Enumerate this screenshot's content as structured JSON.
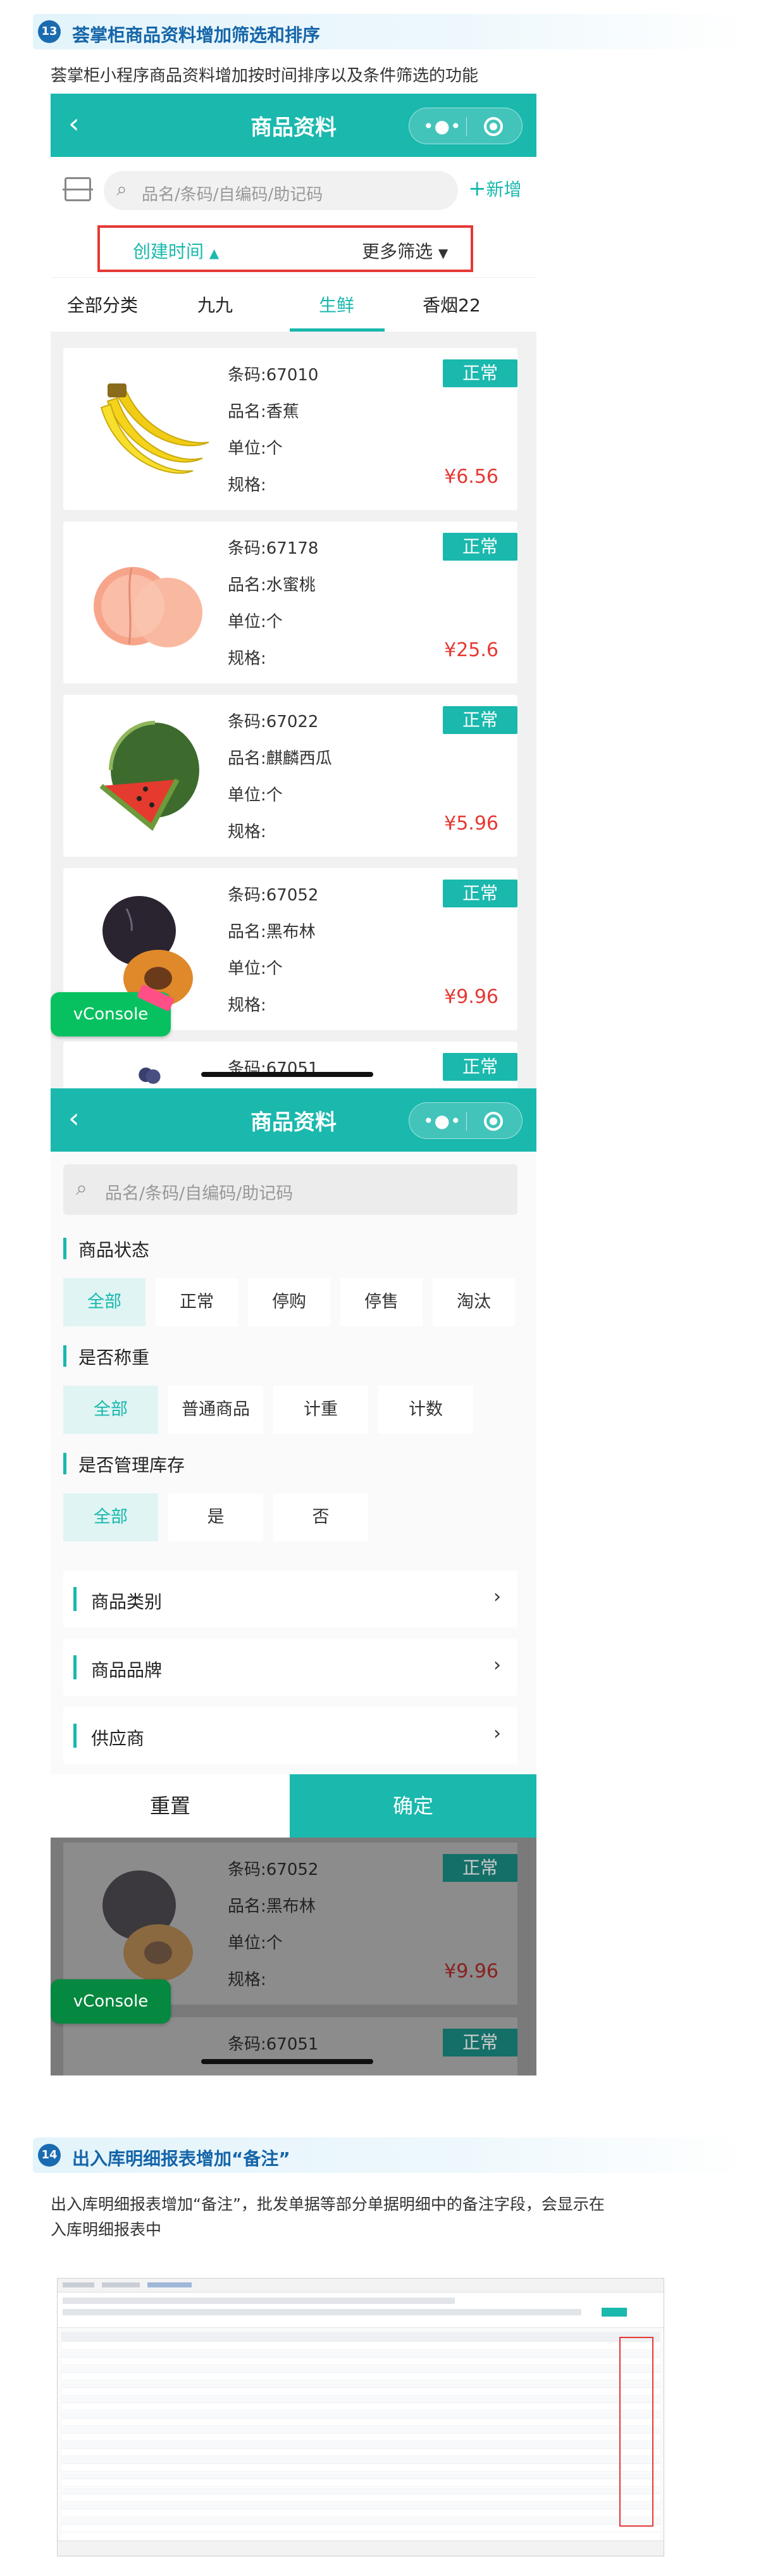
{
  "section13": {
    "number": "13",
    "title": "荟掌柜商品资料增加筛选和排序",
    "description": "荟掌柜小程序商品资料增加按时间排序以及条件筛选的功能"
  },
  "list_screen": {
    "nav_title": "商品资料",
    "search_placeholder": "品名/条码/自编码/助记码",
    "add_label": "新增",
    "sort_time": "创建时间",
    "more_filter": "更多筛选",
    "categories": [
      "全部分类",
      "九九",
      "生鲜",
      "香烟22"
    ],
    "active_category": "生鲜",
    "products": [
      {
        "barcode": "条码:67010",
        "name": "品名:香蕉",
        "unit": "单位:个",
        "spec": "规格:",
        "price": "¥6.56",
        "status": "正常",
        "icon": "banana"
      },
      {
        "barcode": "条码:67178",
        "name": "品名:水蜜桃",
        "unit": "单位:个",
        "spec": "规格:",
        "price": "¥25.6",
        "status": "正常",
        "icon": "peach"
      },
      {
        "barcode": "条码:67022",
        "name": "品名:麒麟西瓜",
        "unit": "单位:个",
        "spec": "规格:",
        "price": "¥5.96",
        "status": "正常",
        "icon": "watermelon"
      },
      {
        "barcode": "条码:67052",
        "name": "品名:黑布林",
        "unit": "单位:个",
        "spec": "规格:",
        "price": "¥9.96",
        "status": "正常",
        "icon": "plum"
      },
      {
        "barcode": "条码:67051",
        "status": "正常",
        "icon": "grape"
      }
    ],
    "vconsole_label": "vConsole"
  },
  "filter_screen": {
    "nav_title": "商品资料",
    "search_placeholder": "品名/条码/自编码/助记码",
    "groups": [
      {
        "label": "商品状态",
        "options": [
          "全部",
          "正常",
          "停购",
          "停售",
          "淘汰"
        ]
      },
      {
        "label": "是否称重",
        "options": [
          "全部",
          "普通商品",
          "计重",
          "计数"
        ]
      },
      {
        "label": "是否管理库存",
        "options": [
          "全部",
          "是",
          "否"
        ]
      }
    ],
    "rows": [
      "商品类别",
      "商品品牌",
      "供应商"
    ],
    "reset_label": "重置",
    "confirm_label": "确定",
    "bg_product": {
      "barcode": "条码:67052",
      "name": "品名:黑布林",
      "unit": "单位:个",
      "spec": "规格:",
      "price": "¥9.96",
      "status": "正常"
    },
    "bg_product2": {
      "barcode": "条码:67051",
      "status": "正常"
    },
    "vconsole_label": "vConsole"
  },
  "section14": {
    "number": "14",
    "title": "出入库明细报表增加“备注”",
    "description_line1": "出入库明细报表增加“备注”，批发单据等部分单据明细中的备注字段，会显示在",
    "description_line2": "入库明细报表中"
  },
  "colors": {
    "primary": "#1ab8ad",
    "highlight": "#e53935",
    "heading": "#1565a8"
  }
}
